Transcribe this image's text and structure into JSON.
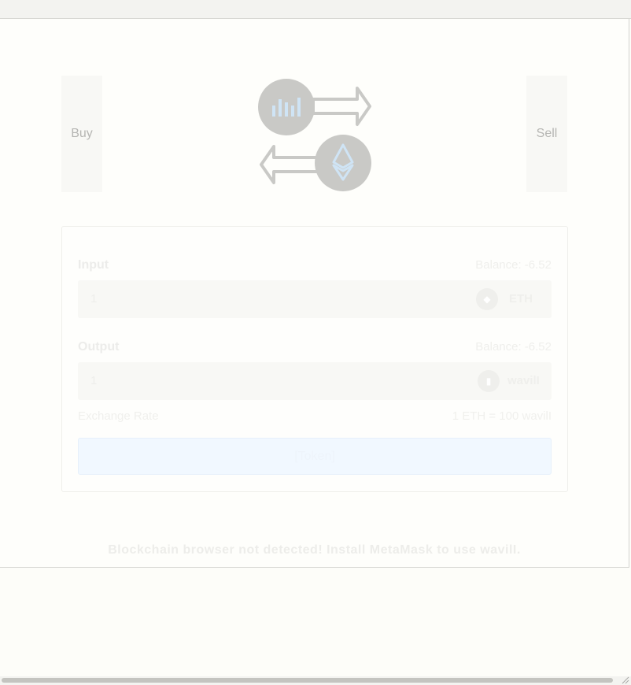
{
  "trade": {
    "buy_label": "Buy",
    "sell_label": "Sell",
    "hero_icon": "exchange-illustration"
  },
  "form": {
    "input": {
      "label": "Input",
      "balance": "Balance: -6.52",
      "value": "1",
      "token": "ETH"
    },
    "output": {
      "label": "Output",
      "balance": "Balance: -6.52",
      "value": "1",
      "token": "wavilI"
    },
    "rate_label": "Exchange Rate",
    "rate_value": "1 ETH = 100 wavilI",
    "submit_label": "[Token]"
  },
  "notice": "Blockchain browser not detected! Install MetaMask to use wavilI.",
  "colors": {
    "accent": "#cfe4f5",
    "icon_grey": "#c9c9c6",
    "button_bg": "#f1f8ff"
  }
}
